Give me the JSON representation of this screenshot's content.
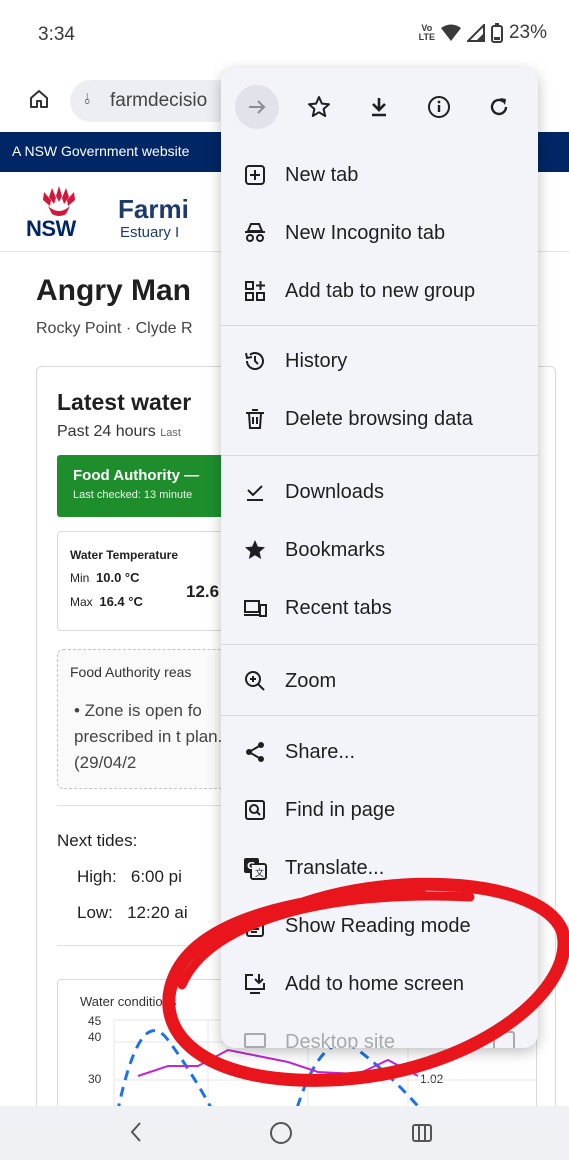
{
  "status_bar": {
    "time": "3:34",
    "volte_label_1": "Vo",
    "volte_label_2": "LTE",
    "battery": "23%"
  },
  "url_bar": {
    "url_text": "farmdecisio"
  },
  "gov_banner": {
    "text": "A NSW Government website"
  },
  "site_header": {
    "logo_text": "NSW",
    "title": "Farmi",
    "subtitle": "Estuary I"
  },
  "page": {
    "title": "Angry Man",
    "subtitle": "Rocky Point · Clyde R"
  },
  "card": {
    "title": "Latest water",
    "period": "Past 24 hours",
    "period_small": "Last",
    "food_authority": {
      "title": "Food Authority —",
      "last_checked": "Last checked: 13 minute"
    },
    "water_temperature": {
      "label": "Water Temperature",
      "min_label": "Min",
      "min_value": "10.0 °C",
      "max_label": "Max",
      "max_value": "16.4 °C",
      "current": "12.6"
    },
    "reason": {
      "title": "Food Authority reas",
      "bullet": "• Zone is open fo prescribed in t plan. (29/04/2"
    },
    "tides": {
      "title": "Next tides:",
      "high_label": "High:",
      "high_value": "6:00 pi",
      "low_label": "Low:",
      "low_value": "12:20 ai"
    },
    "chart": {
      "title": "Water conditions",
      "y_ticks": [
        "45",
        "40",
        "30"
      ],
      "y2_tick": "1.02"
    }
  },
  "menu": {
    "toolbar": [
      "forward-icon",
      "star-icon",
      "download-icon",
      "info-icon",
      "refresh-icon"
    ],
    "items": [
      {
        "label": "New tab",
        "icon": "new-tab-icon"
      },
      {
        "label": "New Incognito tab",
        "icon": "incognito-icon"
      },
      {
        "label": "Add tab to new group",
        "icon": "tab-group-icon"
      },
      {
        "label": "History",
        "icon": "history-icon"
      },
      {
        "label": "Delete browsing data",
        "icon": "trash-icon"
      },
      {
        "label": "Downloads",
        "icon": "downloads-icon"
      },
      {
        "label": "Bookmarks",
        "icon": "bookmark-star-icon"
      },
      {
        "label": "Recent tabs",
        "icon": "recent-tabs-icon"
      },
      {
        "label": "Zoom",
        "icon": "zoom-icon"
      },
      {
        "label": "Share...",
        "icon": "share-icon"
      },
      {
        "label": "Find in page",
        "icon": "find-in-page-icon"
      },
      {
        "label": "Translate...",
        "icon": "translate-icon"
      },
      {
        "label": "Show Reading mode",
        "icon": "reading-mode-icon"
      },
      {
        "label": "Add to home screen",
        "icon": "add-to-home-icon"
      },
      {
        "label": "Desktop site",
        "icon": "desktop-site-icon"
      }
    ]
  },
  "colors": {
    "gov_banner": "#002664",
    "fa_green": "#1e8e2d",
    "annotation_red": "#e8161c",
    "menu_bg": "#f2f4f9"
  }
}
